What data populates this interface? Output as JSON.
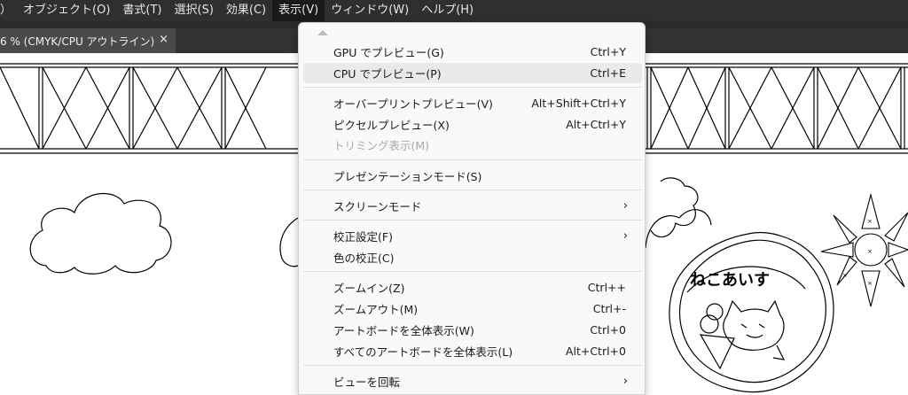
{
  "menubar": {
    "items": [
      "）",
      "オブジェクト(O)",
      "書式(T)",
      "選択(S)",
      "効果(C)",
      "表示(V)",
      "ウィンドウ(W)",
      "ヘルプ(H)"
    ]
  },
  "tab": {
    "title": "6 % (CMYK/CPU アウトライン)",
    "close": "×"
  },
  "view_menu": {
    "items": [
      {
        "label": "GPU でプレビュー(G)",
        "shortcut": "Ctrl+Y"
      },
      {
        "label": "CPU でプレビュー(P)",
        "shortcut": "Ctrl+E"
      },
      {
        "label": "オーバープリントプレビュー(V)",
        "shortcut": "Alt+Shift+Ctrl+Y"
      },
      {
        "label": "ピクセルプレビュー(X)",
        "shortcut": "Alt+Ctrl+Y"
      },
      {
        "label": "トリミング表示(M)",
        "shortcut": ""
      },
      {
        "label": "プレゼンテーションモード(S)",
        "shortcut": ""
      },
      {
        "label": "スクリーンモード",
        "shortcut": ""
      },
      {
        "label": "校正設定(F)",
        "shortcut": ""
      },
      {
        "label": "色の校正(C)",
        "shortcut": ""
      },
      {
        "label": "ズームイン(Z)",
        "shortcut": "Ctrl++"
      },
      {
        "label": "ズームアウト(M)",
        "shortcut": "Ctrl+-"
      },
      {
        "label": "アートボードを全体表示(W)",
        "shortcut": "Ctrl+0"
      },
      {
        "label": "すべてのアートボードを全体表示(L)",
        "shortcut": "Alt+Ctrl+0"
      },
      {
        "label": "ビューを回転",
        "shortcut": ""
      }
    ],
    "submenu_arrow": "›"
  },
  "artwork": {
    "logo_text": "ねこあいす"
  }
}
